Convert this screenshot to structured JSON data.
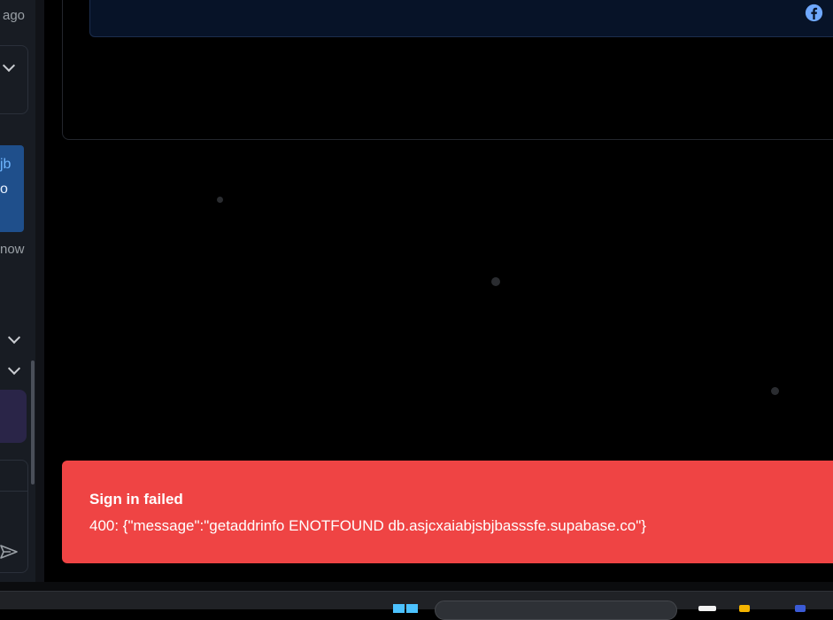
{
  "sidebar": {
    "timestamp_suffix": "ago",
    "message_fragment_line1": "jb",
    "message_fragment_line2": "o",
    "message_time": "now"
  },
  "toast": {
    "title": "Sign in failed",
    "description": "400: {\"message\":\"getaddrinfo ENOTFOUND db.asjcxaiabjsbjbasssfe.supabase.co\"}",
    "background_color": "#ef4444"
  },
  "icons": {
    "share": "facebook-icon",
    "send": "send-icon"
  }
}
